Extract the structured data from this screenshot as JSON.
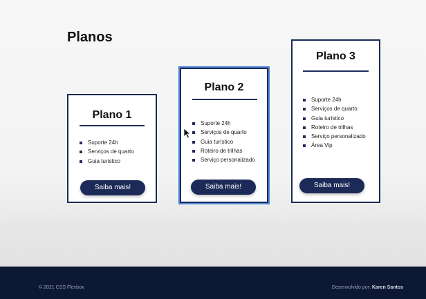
{
  "page": {
    "title": "Planos"
  },
  "plans": [
    {
      "name": "Plano 1",
      "features": [
        "Suporte 24h",
        "Serviços de quarto",
        "Guia turístico"
      ],
      "button_label": "Saiba mais!"
    },
    {
      "name": "Plano 2",
      "features": [
        "Suporte 24h",
        "Serviços de quarto",
        "Guia turístico",
        "Roteiro de trilhas",
        "Serviço personalizado"
      ],
      "button_label": "Saiba mais!"
    },
    {
      "name": "Plano 3",
      "features": [
        "Suporte 24h",
        "Serviços de quarto",
        "Guia turístico",
        "Roteiro de trilhas",
        "Serviço personalizado",
        "Área Vip"
      ],
      "button_label": "Saiba mais!"
    }
  ],
  "footer": {
    "copyright": "© 2021 CSS Flexbox",
    "developed_by_label": "Desenvolvido por:",
    "developer_name": "Karen Santos"
  },
  "colors": {
    "accent": "#1c2a58",
    "footer_bg": "#0d1934",
    "highlight_border": "#4d86d9"
  }
}
